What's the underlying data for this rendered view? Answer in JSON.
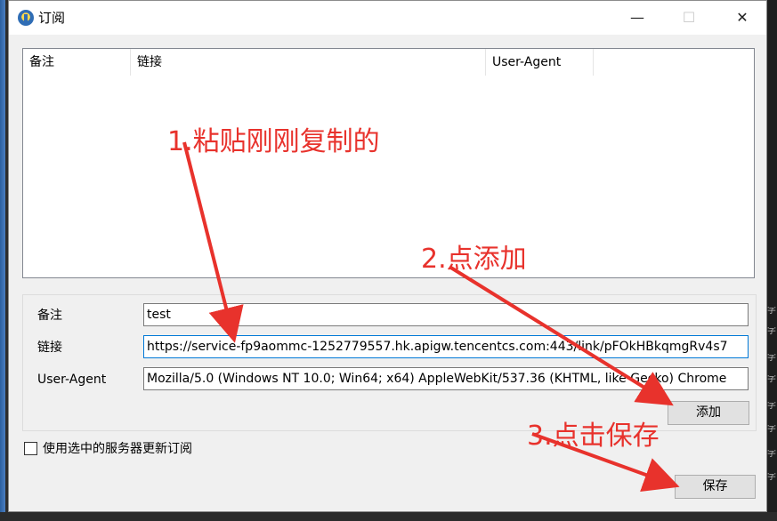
{
  "window": {
    "title": "订阅",
    "minimize_glyph": "—",
    "maximize_glyph": "☐",
    "close_glyph": "✕"
  },
  "list": {
    "columns": [
      "备注",
      "链接",
      "User-Agent"
    ]
  },
  "form": {
    "remark_label": "备注",
    "remark_value": "test",
    "link_label": "链接",
    "link_value": "https://service-fp9aommc-1252779557.hk.apigw.tencentcs.com:443/link/pFOkHBkqmgRv4s7",
    "ua_label": "User-Agent",
    "ua_value": "Mozilla/5.0 (Windows NT 10.0; Win64; x64) AppleWebKit/537.36 (KHTML, like Gecko) Chrome",
    "add_button": "添加"
  },
  "checkbox": {
    "label": "使用选中的服务器更新订阅",
    "checked": false
  },
  "save_button": "保存",
  "annotations": {
    "step1": "1.粘贴刚刚复制的",
    "step2": "2.点添加",
    "step3": "3.点击保存",
    "color": "#e8322c"
  },
  "desktop_glyph": "字"
}
